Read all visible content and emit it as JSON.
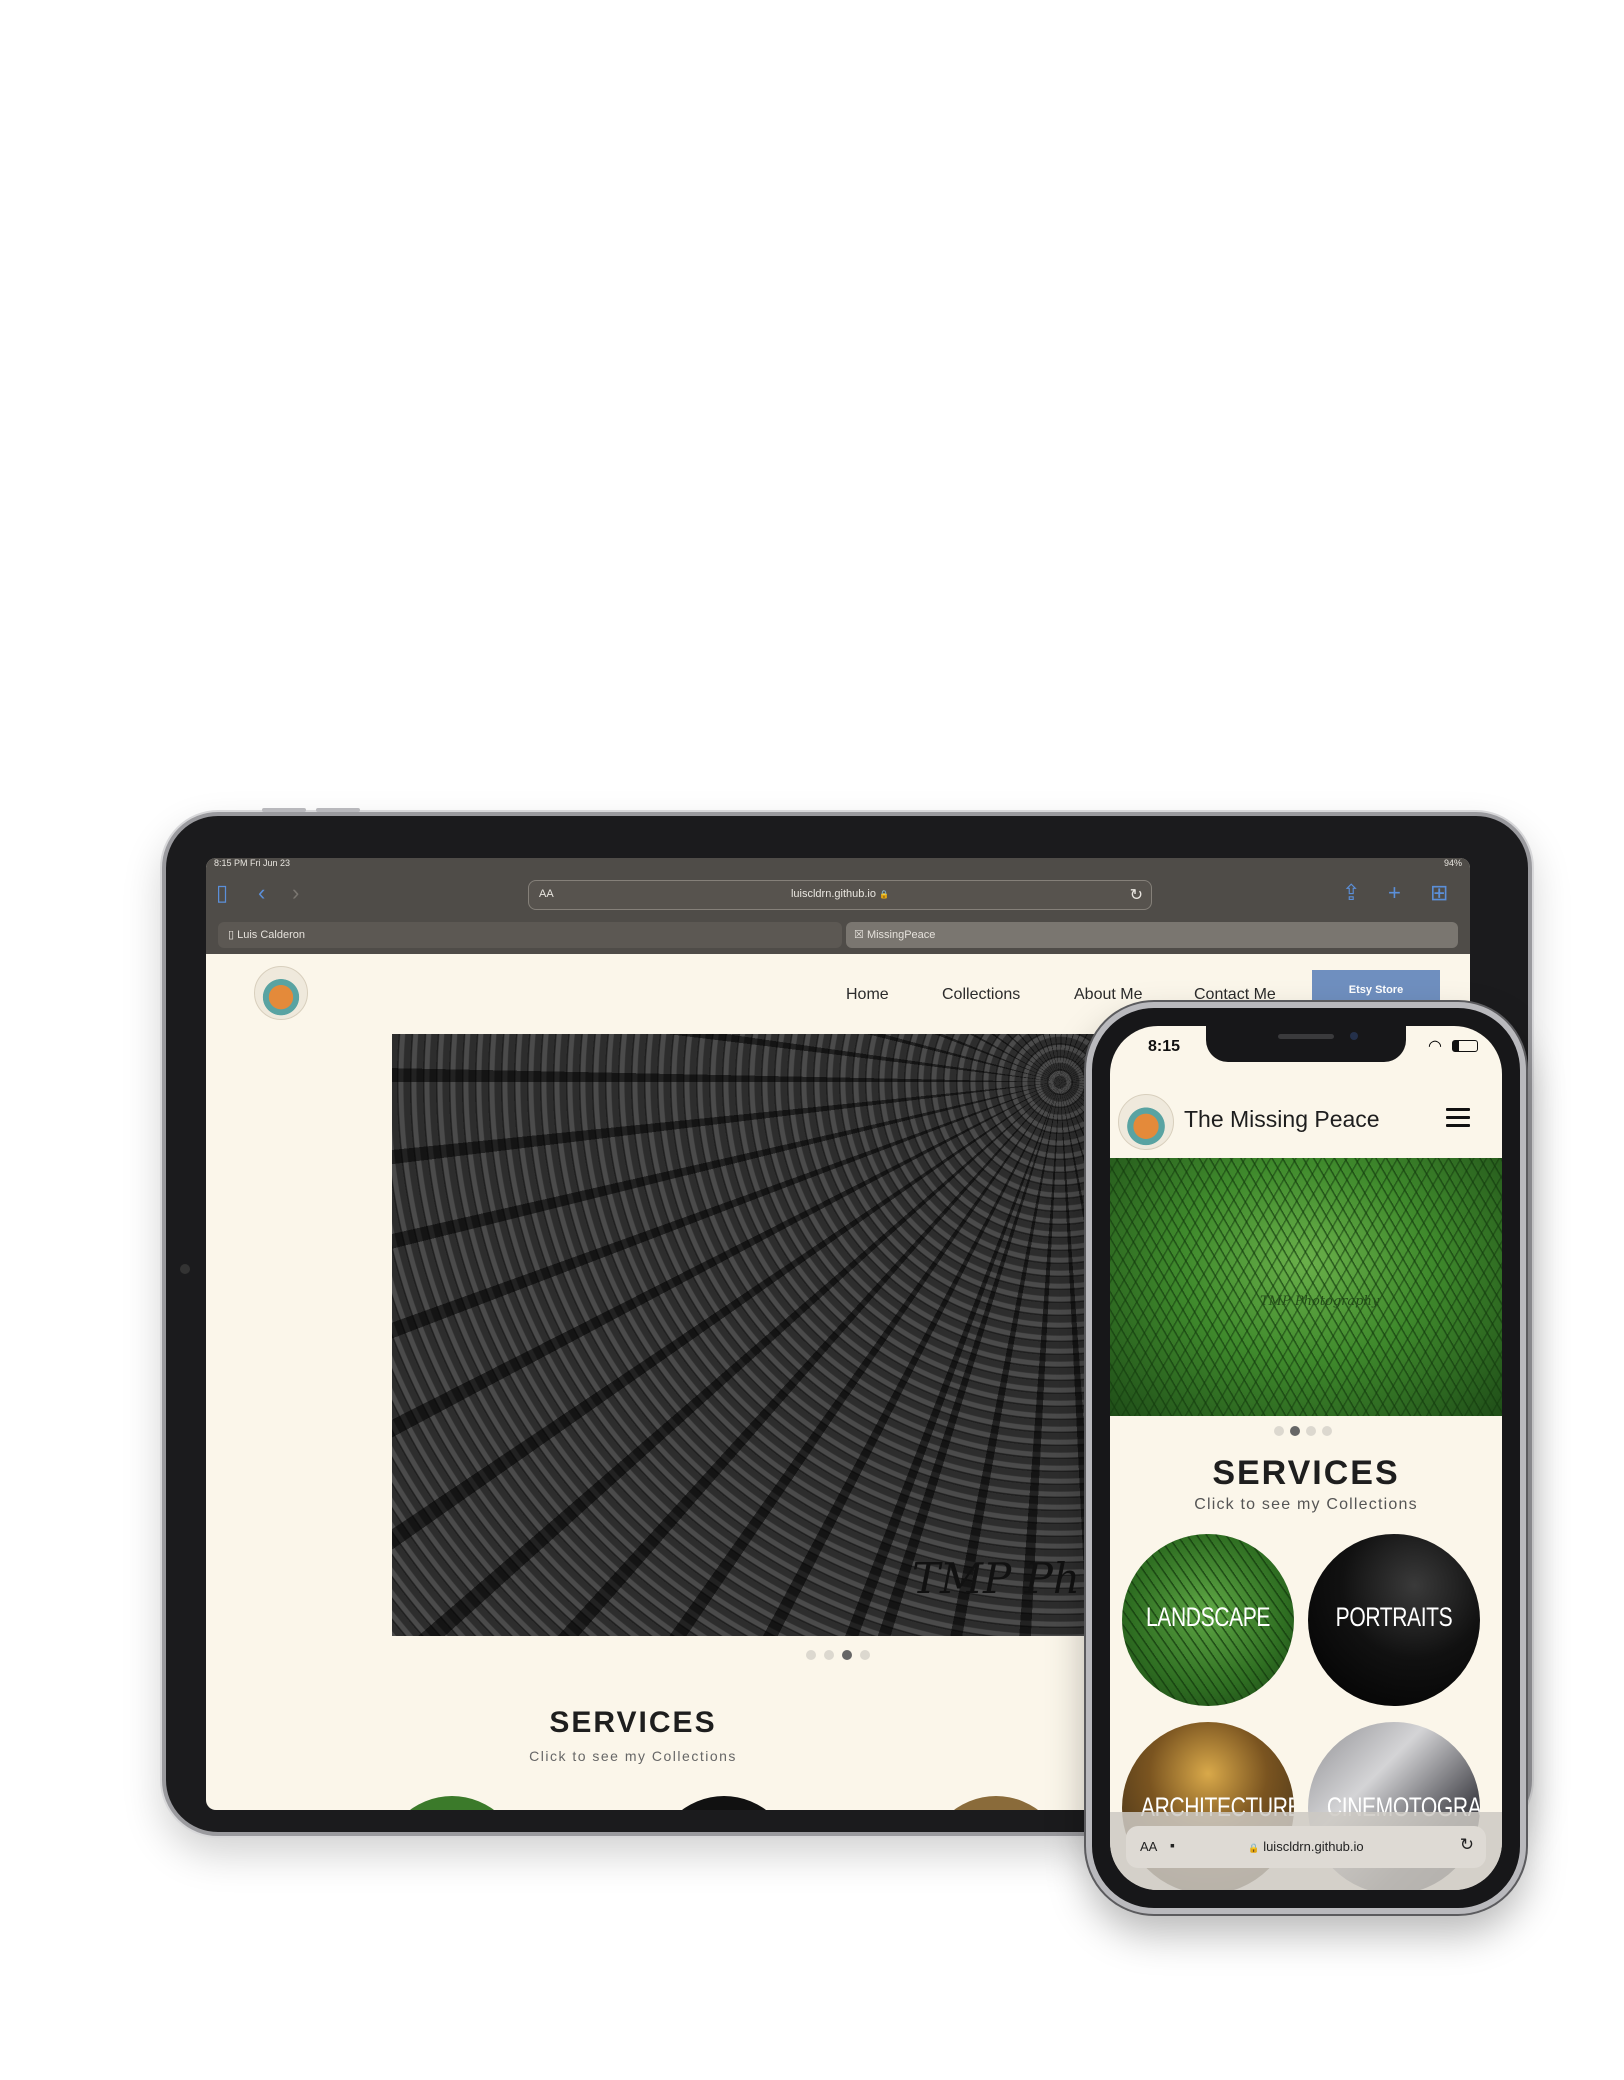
{
  "tablet": {
    "status_bar": {
      "time": "8:15 PM  Fri Jun 23",
      "battery": "94%"
    },
    "toolbar": {
      "address_aa": "AA",
      "url": "luiscldrn.github.io",
      "lock_glyph": "🔒",
      "icons": [
        "sidebar-icon",
        "back-icon",
        "forward-icon",
        "reload-icon",
        "share-icon",
        "add-tab-icon",
        "tabs-grid-icon"
      ]
    },
    "tabs": [
      {
        "label": "Luis Calderon"
      },
      {
        "label": "MissingPeace"
      }
    ],
    "site": {
      "nav": [
        {
          "label": "Home"
        },
        {
          "label": "Collections"
        },
        {
          "label": "About Me"
        },
        {
          "label": "Contact Me"
        }
      ],
      "etsy_label": "Etsy Store",
      "hero_watermark": "TMP Ph",
      "carousel": {
        "count": 4,
        "active_index": 2
      },
      "services_title": "SERVICES",
      "services_subtitle": "Click to see my Collections"
    }
  },
  "phone": {
    "status_bar": {
      "time": "8:15"
    },
    "site": {
      "brand": "The Missing Peace",
      "hero_watermark": "TMP Photography",
      "carousel": {
        "count": 4,
        "active_index": 1
      },
      "services_title": "SERVICES",
      "services_subtitle": "Click to see my Collections",
      "collections": [
        {
          "label": "LANDSCAPE"
        },
        {
          "label": "PORTRAITS"
        },
        {
          "label": "ARCHITECTURE"
        },
        {
          "label": "CINEMOTOGRAPHY"
        }
      ]
    },
    "url_bar": {
      "aa": "AA",
      "url": "luiscldrn.github.io"
    }
  },
  "colors": {
    "page_bg": "#fbf6ea",
    "browser_chrome": "#4f4c48",
    "accent_link": "#5b8fd9",
    "etsy_button": "#6f8fbf"
  }
}
